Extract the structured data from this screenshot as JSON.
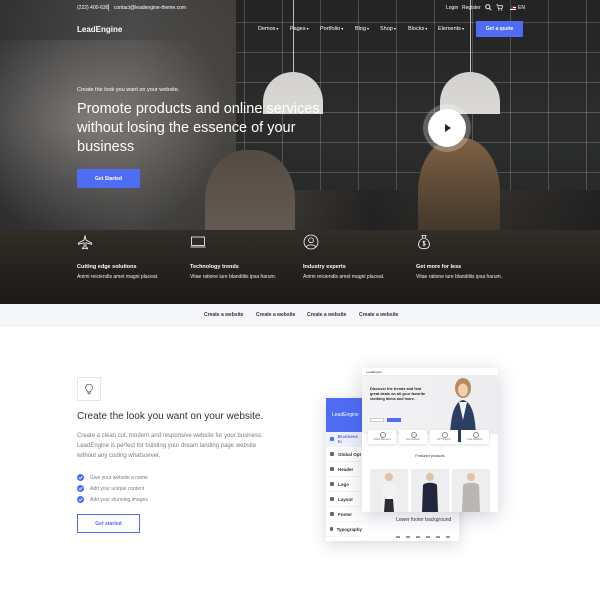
{
  "topbar": {
    "phone": "(222) 400-630",
    "email": "contact@leadengine-theme.com",
    "login": "Login",
    "register": "Register",
    "search_icon": "search-icon",
    "cart_icon": "cart-icon",
    "language": "EN"
  },
  "nav": {
    "logo": "LeadEngine",
    "items": [
      {
        "label": "Demos"
      },
      {
        "label": "Pages"
      },
      {
        "label": "Portfolio"
      },
      {
        "label": "Blog"
      },
      {
        "label": "Shop"
      },
      {
        "label": "Blocks"
      },
      {
        "label": "Elements"
      }
    ],
    "cta": "Get a quote"
  },
  "hero": {
    "kicker": "Create the look you want on your website.",
    "title": "Promote products and online services without losing the essence of your business",
    "cta": "Get Started",
    "play_icon": "play-icon"
  },
  "features": [
    {
      "icon": "airplane-icon",
      "title": "Cutting edge solutions",
      "desc": "Animi reiciendis amet magni placeat."
    },
    {
      "icon": "monitor-icon",
      "title": "Technology trends",
      "desc": "Vitae ratione iure blanditiis ipsa harum."
    },
    {
      "icon": "user-circle-icon",
      "title": "Industry experts",
      "desc": "Animi reiciendis amet magni placeat."
    },
    {
      "icon": "money-bag-icon",
      "title": "Get more for less",
      "desc": "Vitae ratione iure blanditiis ipsa harum."
    }
  ],
  "subnav": {
    "items": [
      {
        "label": "Create a website"
      },
      {
        "label": "Create a website"
      },
      {
        "label": "Create a website"
      },
      {
        "label": "Create a website"
      }
    ]
  },
  "section": {
    "icon": "lightbulb-icon",
    "title": "Create the look you want on your website.",
    "desc": "Create a clean cut, modern and responsive website for your business. LeadEngine is perfect for building your dream landing page website without any coding whatsoever.",
    "checks": [
      {
        "label": "Give your website a name"
      },
      {
        "label": "Add your unique content"
      },
      {
        "label": "Add your stunning images"
      }
    ],
    "cta": "Get started"
  },
  "mockup": {
    "panel_title": "LeadEngine",
    "menu": [
      {
        "label": "Business In"
      },
      {
        "label": "Global Opt"
      },
      {
        "label": "Header"
      },
      {
        "label": "Logo"
      },
      {
        "label": "Layout"
      },
      {
        "label": "Footer"
      },
      {
        "label": "Typography"
      }
    ],
    "lower_label": "Lower footer background",
    "site_logo": "LeadEngine",
    "site_hero": "Discover the trends and find great deals on all your favorite clothing items and more.",
    "site_cards": [
      "Online Payment",
      "Free Delivery",
      "24/7 Support",
      "Free Shipping"
    ],
    "site_featured": "Featured products"
  },
  "colors": {
    "accent": "#4f6cf5",
    "subnav_bg": "#f6f7fb"
  }
}
